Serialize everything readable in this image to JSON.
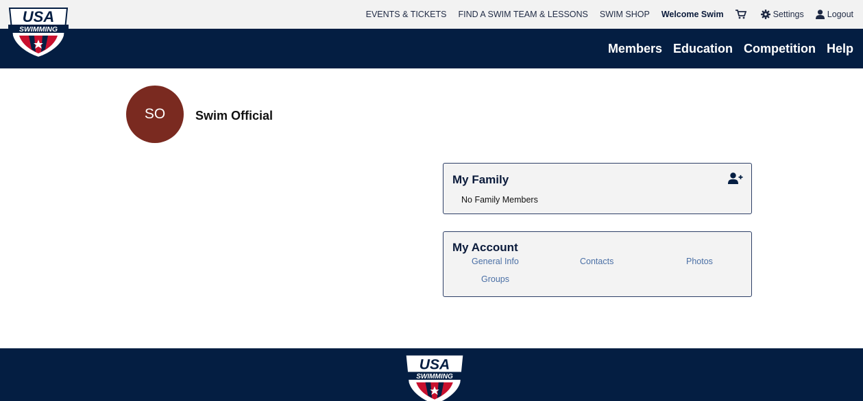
{
  "brand": {
    "logo_top": "USA",
    "logo_bottom": "SWIMMING"
  },
  "utility_nav": {
    "events": "EVENTS & TICKETS",
    "find_team": "FIND A SWIM TEAM & LESSONS",
    "shop": "SWIM SHOP",
    "welcome": "Welcome Swim",
    "cart_icon": "cart-icon",
    "settings": "Settings",
    "settings_icon": "gear-icon",
    "logout": "Logout",
    "logout_icon": "user-icon"
  },
  "main_nav": {
    "members": "Members",
    "education": "Education",
    "competition": "Competition",
    "help": "Help"
  },
  "profile": {
    "initials": "SO",
    "name": "Swim Official",
    "avatar_color": "#7a2a20"
  },
  "family": {
    "title": "My Family",
    "empty_text": "No Family Members",
    "add_icon": "add-user-icon"
  },
  "account": {
    "title": "My Account",
    "links": {
      "general_info": "General Info",
      "contacts": "Contacts",
      "photos": "Photos",
      "groups": "Groups"
    }
  },
  "colors": {
    "navy": "#041e42",
    "topbar": "#f2f2f2",
    "link": "#4a6fa5",
    "usa_red": "#c8102e"
  }
}
